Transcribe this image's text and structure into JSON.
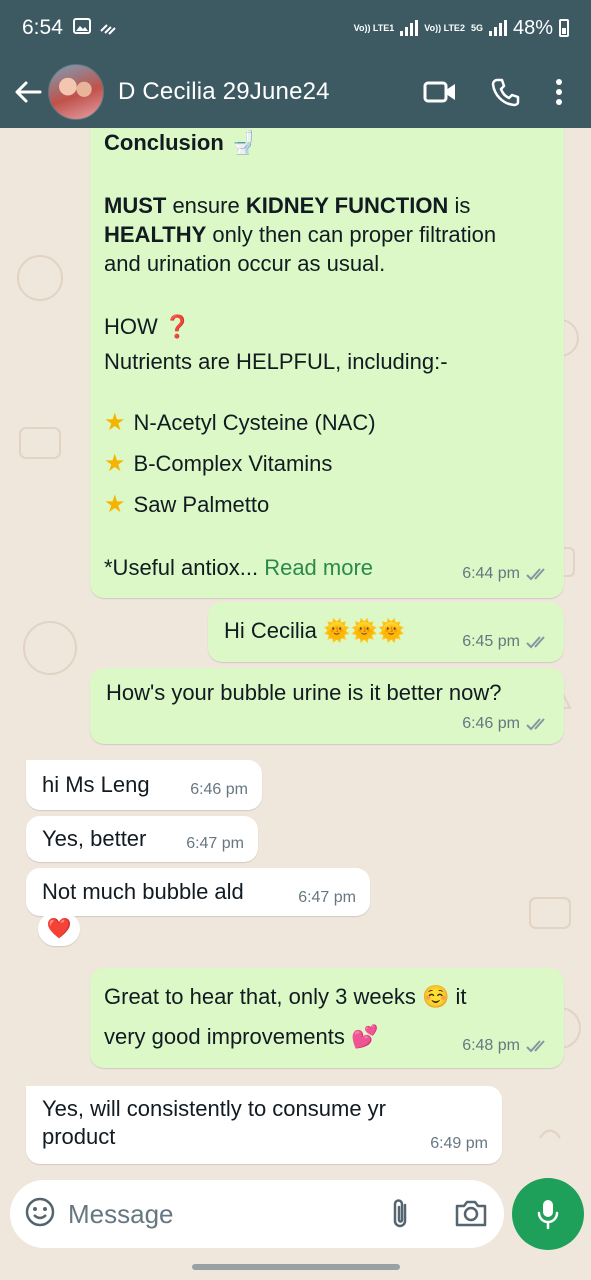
{
  "status_bar": {
    "time": "6:54",
    "net1": "Vo)) LTE1",
    "net2": "Vo)) LTE2",
    "net5g": "5G",
    "battery": "48%"
  },
  "header": {
    "contact_name": "D Cecilia 29June24",
    "icons": [
      "back-arrow-icon",
      "video-call-icon",
      "phone-icon",
      "more-vert-icon"
    ]
  },
  "messages": {
    "m1": {
      "heading": "Conclusion",
      "heading_emoji": "🚽",
      "p1_bold1": "MUST",
      "p1_text1": " ensure ",
      "p1_bold2": "KIDNEY FUNCTION",
      "p1_text2": " is",
      "p1_bold3": "HEALTHY",
      "p1_text3": " only then can proper filtration",
      "p1_line3": "and urination occur as usual.",
      "how": "HOW",
      "how_emoji": "❓",
      "nutrients": "Nutrients are HELPFUL, including:-",
      "items": [
        "N-Acetyl Cysteine (NAC)",
        "B-Complex Vitamins",
        "Saw Palmetto"
      ],
      "truncated": "*Useful antiox...",
      "read_more": "Read more",
      "time": "6:44 pm"
    },
    "m2": {
      "text": "Hi Cecilia",
      "emoji": "🌞🌞🌞",
      "time": "6:45 pm"
    },
    "m3": {
      "text": "How's your bubble urine is it better now?",
      "time": "6:46 pm"
    },
    "m4": {
      "text": "hi Ms Leng",
      "time": "6:46 pm"
    },
    "m5": {
      "text": "Yes, better",
      "time": "6:47 pm"
    },
    "m6": {
      "text": "Not much bubble ald",
      "time": "6:47 pm",
      "reaction": "❤️"
    },
    "m7": {
      "line1": "Great to hear that, only 3 weeks",
      "emoji1": "☺️",
      "line1b": " it",
      "line2": "very good improvements",
      "emoji2": "💕",
      "time": "6:48 pm"
    },
    "m8": {
      "line1": "Yes, will consistently to consume yr",
      "line2": "product",
      "time": "6:49 pm"
    }
  },
  "input": {
    "placeholder": "Message"
  },
  "colors": {
    "header": "#3d5a63",
    "outgoing": "#dcf8c6",
    "incoming": "#ffffff",
    "accent": "#1e9f5a",
    "read_more": "#2b8a4b"
  }
}
